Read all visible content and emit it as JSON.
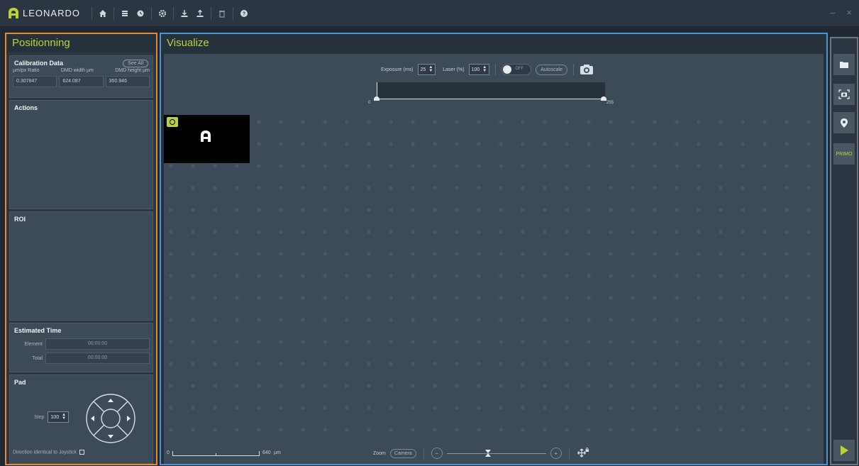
{
  "app": {
    "logo_text": "LEONARDO"
  },
  "toolbar": {
    "icons": [
      "home-icon",
      "list-icon",
      "clock-icon",
      "gear-icon",
      "download-icon",
      "upload-icon",
      "trash-icon",
      "help-icon"
    ],
    "window_controls": {
      "minimize": "–",
      "close": "×"
    }
  },
  "positioning": {
    "title": "Positionning",
    "calibration": {
      "title": "Calibration Data",
      "see_all": "See All",
      "headers": [
        "µm/px Ratio",
        "DMD width µm",
        "DMD height µm"
      ],
      "values": [
        "0.307847",
        "624.087",
        "350.946"
      ]
    },
    "actions_title": "Actions",
    "roi_title": "ROI",
    "estimated_time": {
      "title": "Estimated Time",
      "element_label": "Element",
      "element_value": "00:00:00",
      "total_label": "Total",
      "total_value": "00:00:00"
    },
    "pad": {
      "title": "Pad",
      "step_label": "Step",
      "step_value": "100",
      "joystick_label": "Direction identical to Joystick"
    }
  },
  "visualize": {
    "title": "Visualize",
    "exposure_label": "Exposure (ms)",
    "exposure_value": "25",
    "laser_label": "Laser (%)",
    "laser_value": "100",
    "laser_toggle_text": "OFF",
    "autoscale_label": "Autoscale",
    "hist_min": "0",
    "hist_max": "255",
    "scale_start": "0",
    "scale_end": "640",
    "scale_unit": "µm",
    "zoom_label": "Zoom",
    "zoom_mode": "Camera",
    "zoom_minus": "−",
    "zoom_plus": "+"
  },
  "right_bar": {
    "primo_label": "PRIMO"
  },
  "colors": {
    "accent": "#b9d336",
    "left_border": "#e58a32",
    "center_border": "#4b95d4"
  }
}
